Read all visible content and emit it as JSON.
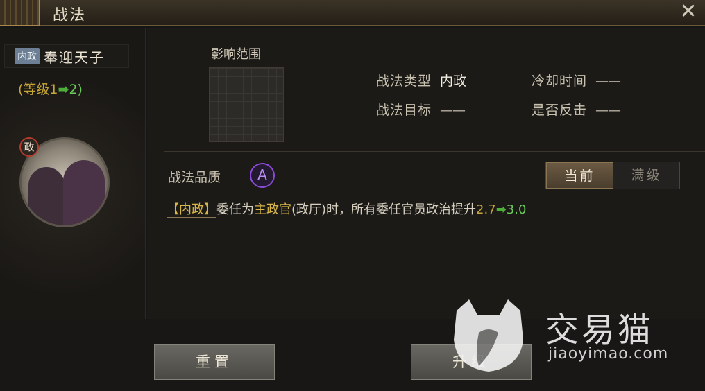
{
  "window": {
    "title": "战法"
  },
  "skill": {
    "type_tag": "内政",
    "name": "奉迎天子",
    "level_text": "(等级1",
    "level_arrow": "➡",
    "level_next": "2)",
    "portrait_badge": "政"
  },
  "details": {
    "range_label": "影响范围",
    "type_label": "战法类型",
    "type_value": "内政",
    "target_label": "战法目标",
    "target_value": "——",
    "cooldown_label": "冷却时间",
    "cooldown_value": "——",
    "counter_label": "是否反击",
    "counter_value": "——",
    "quality_label": "战法品质",
    "quality_value": "A"
  },
  "toggle": {
    "current": "当前",
    "max": "满级"
  },
  "description": {
    "tag": "【内政】",
    "text1": "委任为",
    "highlight": "主政官",
    "text2": "(政厅)时，所有委任官员政治提升",
    "value": "2.7",
    "arrow": "➡",
    "next_value": "3.0"
  },
  "buttons": {
    "reset": "重置",
    "upgrade": "升级"
  },
  "watermark": {
    "brand": "交易猫",
    "url": "jiaoyimao.com"
  },
  "colors": {
    "quality": "#8a4cd8",
    "upgrade_arrow": "#4caf3a",
    "gold": "#c7a637"
  }
}
